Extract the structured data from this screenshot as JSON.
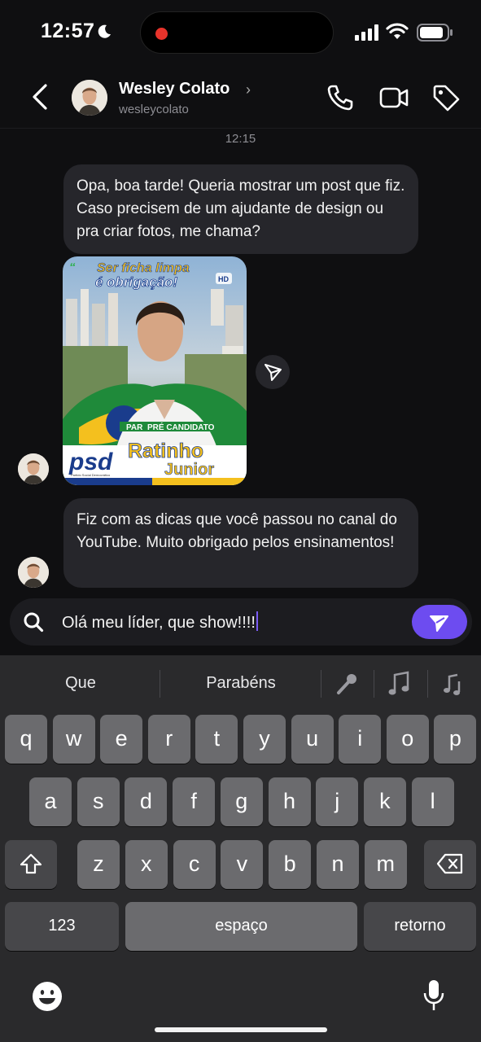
{
  "status": {
    "time": "12:57"
  },
  "header": {
    "name": "Wesley Colato",
    "username": "wesleycolato"
  },
  "conversation": {
    "timestamp": "12:15",
    "messages": [
      {
        "text": "Opa, boa tarde! Queria mostrar um post que fiz. Caso precisem de um ajudante de design ou pra criar fotos, me chama?"
      },
      {
        "text": "Fiz com as dicas que você passou no canal do YouTube. Muito obrigado pelos ensinamentos!"
      }
    ],
    "post": {
      "headline_1": "Ser ficha limpa",
      "headline_2": "é obrigação!",
      "badge": "HD",
      "tag": "PRÉ CANDIDATO",
      "tag_prefix": "PAR",
      "party": "psd",
      "party_sub": "Partido Social Democrático",
      "name_1": "Ratinho",
      "name_2": "Junior"
    }
  },
  "composer": {
    "value": "Olá meu líder, que show!!!!"
  },
  "keyboard": {
    "suggestions": [
      "Que",
      "Parabéns"
    ],
    "row1": [
      "q",
      "w",
      "e",
      "r",
      "t",
      "y",
      "u",
      "i",
      "o",
      "p"
    ],
    "row2": [
      "a",
      "s",
      "d",
      "f",
      "g",
      "h",
      "j",
      "k",
      "l"
    ],
    "row3": [
      "z",
      "x",
      "c",
      "v",
      "b",
      "n",
      "m"
    ],
    "numbers_label": "123",
    "space_label": "espaço",
    "return_label": "retorno"
  },
  "colors": {
    "accent": "#6d4cf0",
    "bubble": "#26262b",
    "background": "#0f0f11"
  }
}
